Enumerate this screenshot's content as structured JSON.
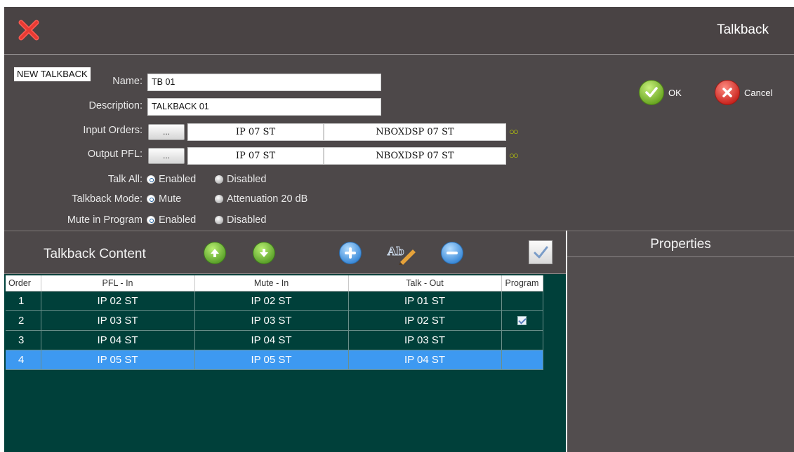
{
  "window": {
    "title": "Talkback"
  },
  "form": {
    "tag": "NEW TALKBACK",
    "name_label": "Name:",
    "name_value": "TB 01",
    "description_label": "Description:",
    "description_value": "TALKBACK 01",
    "input_orders": {
      "label": "Input Orders:",
      "button": "...",
      "source": "IP 07 ST",
      "device": "NBOXDSP 07 ST",
      "link_icon": "link-icon"
    },
    "output_pfl": {
      "label": "Output PFL:",
      "button": "...",
      "source": "IP 07 ST",
      "device": "NBOXDSP 07 ST",
      "link_icon": "link-icon"
    },
    "talk_all": {
      "label": "Talk All:",
      "options": [
        "Enabled",
        "Disabled"
      ],
      "selected": "Enabled"
    },
    "talkback_mode": {
      "label": "Talkback Mode:",
      "options": [
        "Mute",
        "Attenuation 20 dB"
      ],
      "selected": "Mute"
    },
    "mute_in_program": {
      "label": "Mute in Program",
      "options": [
        "Enabled",
        "Disabled"
      ],
      "selected": "Enabled"
    }
  },
  "actions": {
    "ok": {
      "label": "OK",
      "icon": "check-icon",
      "color": "#7fbf2a"
    },
    "cancel": {
      "label": "Cancel",
      "icon": "close-icon",
      "color": "#d8322c"
    }
  },
  "content": {
    "title": "Talkback Content",
    "toolbar_icons": [
      "move-up-icon",
      "move-down-icon",
      "add-icon",
      "rename-icon",
      "remove-icon",
      "check-icon"
    ],
    "columns": [
      "Order",
      "PFL - In",
      "Mute - In",
      "Talk - Out",
      "Program"
    ],
    "rows": [
      {
        "order": "1",
        "pfl": "IP 02 ST",
        "mute": "IP 02 ST",
        "talk": "IP 01 ST",
        "program": false
      },
      {
        "order": "2",
        "pfl": "IP 03 ST",
        "mute": "IP 03 ST",
        "talk": "IP 02 ST",
        "program": true
      },
      {
        "order": "3",
        "pfl": "IP 04 ST",
        "mute": "IP 04 ST",
        "talk": "IP 03 ST",
        "program": false
      },
      {
        "order": "4",
        "pfl": "IP 05 ST",
        "mute": "IP 05 ST",
        "talk": "IP 04 ST",
        "program": false
      }
    ],
    "selected_order": "4",
    "colors": {
      "grid_bg": "#00403a",
      "selected_row": "#3d99f1"
    }
  },
  "properties": {
    "title": "Properties"
  }
}
